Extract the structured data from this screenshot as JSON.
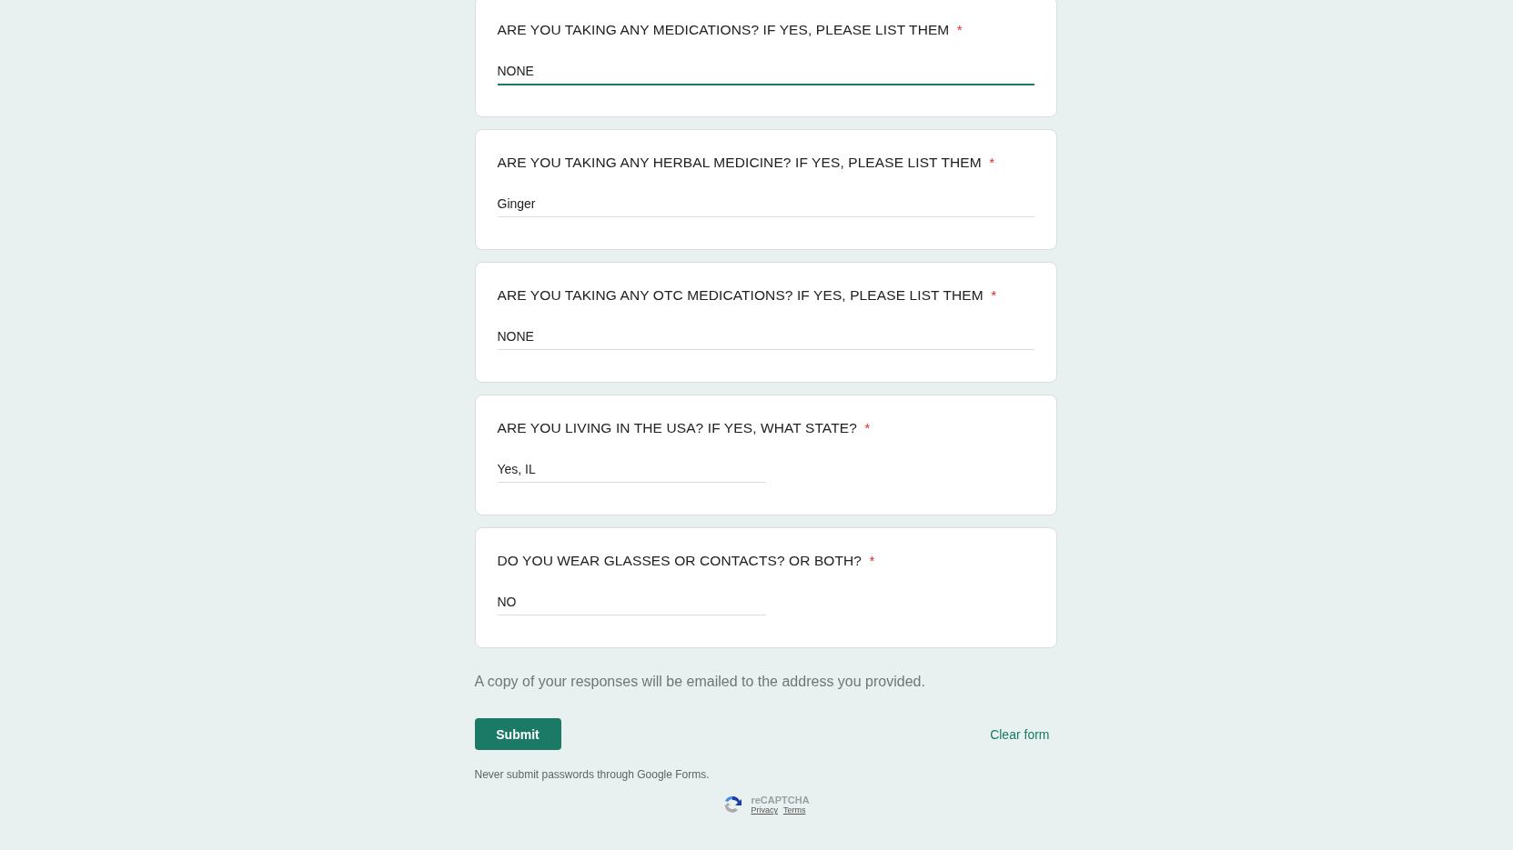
{
  "questions": [
    {
      "label": "ARE YOU TAKING ANY MEDICATIONS? IF YES, PLEASE LIST THEM",
      "required": true,
      "answer": "NONE",
      "kind": "long",
      "focused": true
    },
    {
      "label": "ARE YOU TAKING ANY HERBAL MEDICINE? IF YES, PLEASE LIST THEM",
      "required": true,
      "answer": "Ginger",
      "kind": "long",
      "focused": false
    },
    {
      "label": "ARE YOU TAKING ANY OTC MEDICATIONS? IF YES, PLEASE LIST THEM",
      "required": true,
      "answer": "NONE",
      "kind": "long",
      "focused": false
    },
    {
      "label": "ARE YOU LIVING IN THE USA? IF YES, WHAT STATE?",
      "required": true,
      "answer": "Yes, IL",
      "kind": "short",
      "focused": false
    },
    {
      "label": "DO YOU WEAR GLASSES OR CONTACTS? OR BOTH?",
      "required": true,
      "answer": "NO",
      "kind": "short",
      "focused": false
    }
  ],
  "required_mark": "*",
  "copy_notice": "A copy of your responses will be emailed to the address you provided.",
  "submit": "Submit",
  "clear": "Clear form",
  "password_warning": "Never submit passwords through Google Forms.",
  "recaptcha": {
    "title": "reCAPTCHA",
    "privacy": "Privacy",
    "terms": "Terms"
  }
}
